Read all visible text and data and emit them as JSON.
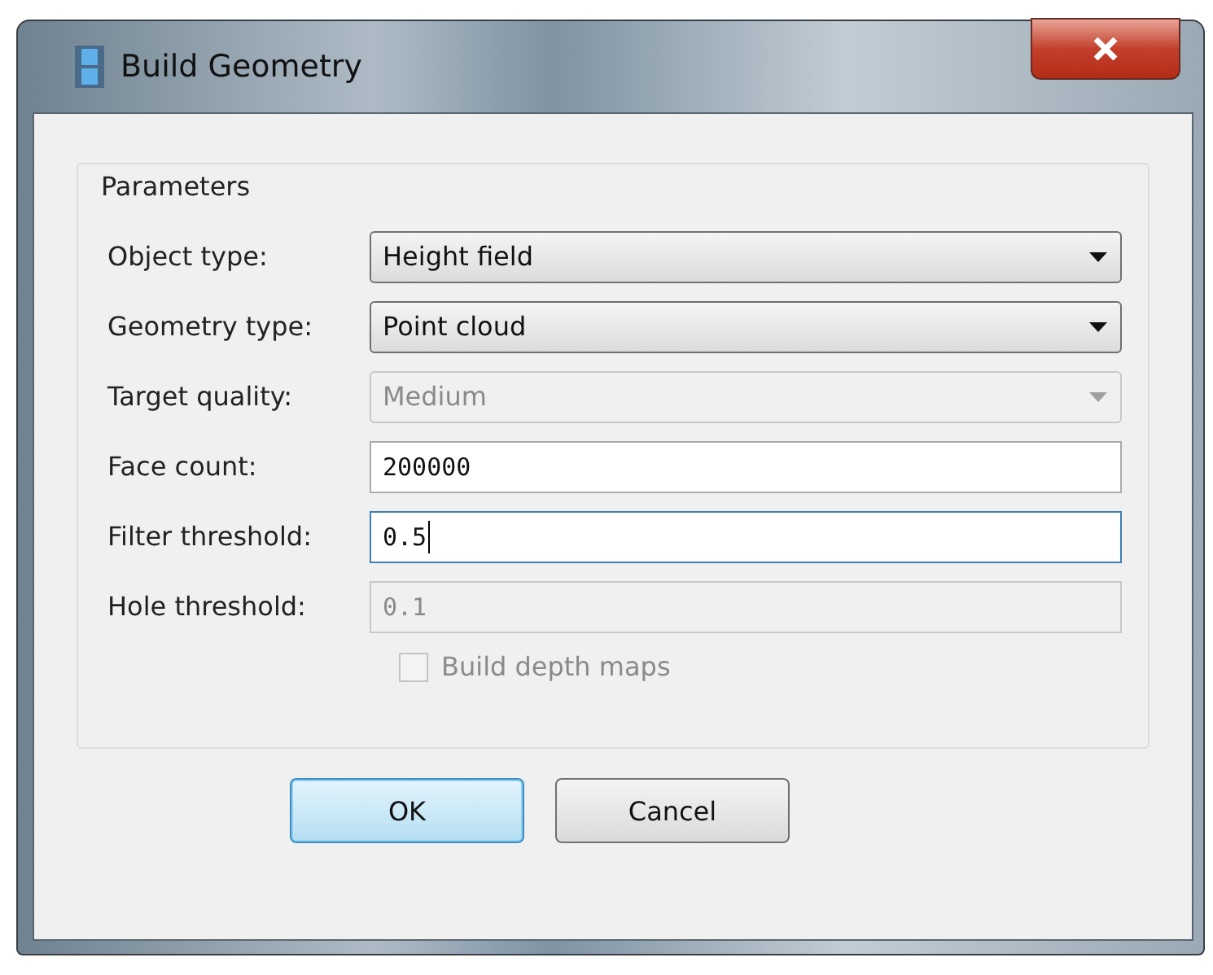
{
  "window": {
    "title": "Build Geometry"
  },
  "group": {
    "title": "Parameters"
  },
  "fields": [
    {
      "label": "Object type:",
      "kind": "combo",
      "value": "Height field",
      "disabled": false
    },
    {
      "label": "Geometry type:",
      "kind": "combo",
      "value": "Point cloud",
      "disabled": false
    },
    {
      "label": "Target quality:",
      "kind": "combo",
      "value": "Medium",
      "disabled": true
    },
    {
      "label": "Face count:",
      "kind": "text",
      "value": "200000",
      "disabled": false,
      "focused": false
    },
    {
      "label": "Filter threshold:",
      "kind": "text",
      "value": "0.5",
      "disabled": false,
      "focused": true
    },
    {
      "label": "Hole threshold:",
      "kind": "text",
      "value": "0.1",
      "disabled": true,
      "focused": false
    }
  ],
  "checkbox": {
    "label": "Build depth maps",
    "checked": false,
    "disabled": true
  },
  "buttons": [
    {
      "label": "OK",
      "default": true
    },
    {
      "label": "Cancel",
      "default": false
    }
  ]
}
